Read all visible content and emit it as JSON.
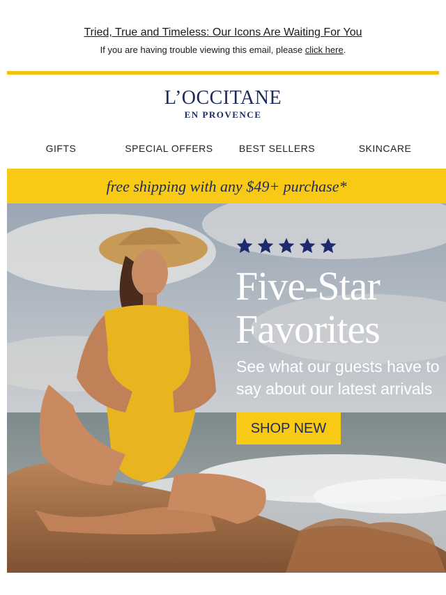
{
  "preheader": {
    "title": "Tried, True and Timeless: Our Icons Are Waiting For You",
    "trouble_text": "If you are having trouble viewing this email, please ",
    "trouble_link": "click here",
    "trouble_end": "."
  },
  "logo": {
    "main": "L’OCCITANE",
    "sub": "EN PROVENCE"
  },
  "nav": {
    "items": [
      "GIFTS",
      "SPECIAL OFFERS",
      "BEST SELLERS",
      "SKINCARE"
    ]
  },
  "promo": {
    "text": "free shipping with any $49+ purchase*"
  },
  "hero": {
    "rating_stars": 5,
    "title_line1": "Five-Star",
    "title_line2": "Favorites",
    "subtitle_line1": "See what our guests have to",
    "subtitle_line2": "say about our latest arrivals",
    "cta_label": "SHOP NEW"
  },
  "colors": {
    "brand_yellow": "#f8c915",
    "brand_navy": "#1d2a5c"
  }
}
